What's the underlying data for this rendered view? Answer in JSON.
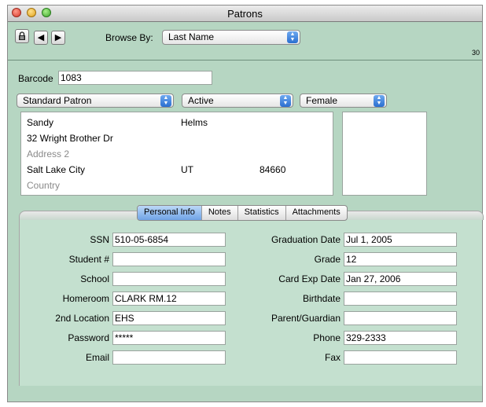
{
  "window": {
    "title": "Patrons"
  },
  "toolbar": {
    "lock_icon": "lock-icon",
    "prev_arrow": "◀",
    "next_arrow": "▶",
    "browse_label": "Browse By:",
    "browse_value": "Last Name",
    "record_count": "30"
  },
  "record": {
    "barcode_label": "Barcode",
    "barcode": "1083",
    "patron_type": "Standard Patron",
    "status": "Active",
    "gender": "Female"
  },
  "address": {
    "first_name": "Sandy",
    "last_name": "Helms",
    "address1": "32 Wright Brother Dr",
    "address2_placeholder": "Address 2",
    "city": "Salt Lake City",
    "state": "UT",
    "zip": "84660",
    "country_placeholder": "Country"
  },
  "tabs": [
    {
      "label": "Personal Info",
      "active": true
    },
    {
      "label": "Notes",
      "active": false
    },
    {
      "label": "Statistics",
      "active": false
    },
    {
      "label": "Attachments",
      "active": false
    }
  ],
  "personal": {
    "left": [
      {
        "label": "SSN",
        "value": "510-05-6854"
      },
      {
        "label": "Student #",
        "value": ""
      },
      {
        "label": "School",
        "value": ""
      },
      {
        "label": "Homeroom",
        "value": "CLARK RM.12"
      },
      {
        "label": "2nd Location",
        "value": "EHS"
      },
      {
        "label": "Password",
        "value": "*****"
      },
      {
        "label": "Email",
        "value": ""
      }
    ],
    "right": [
      {
        "label": "Graduation Date",
        "value": "Jul 1, 2005"
      },
      {
        "label": "Grade",
        "value": "12"
      },
      {
        "label": "Card Exp Date",
        "value": "Jan 27, 2006"
      },
      {
        "label": "Birthdate",
        "value": ""
      },
      {
        "label": "Parent/Guardian",
        "value": ""
      },
      {
        "label": "Phone",
        "value": "329-2333"
      },
      {
        "label": "Fax",
        "value": ""
      }
    ]
  }
}
